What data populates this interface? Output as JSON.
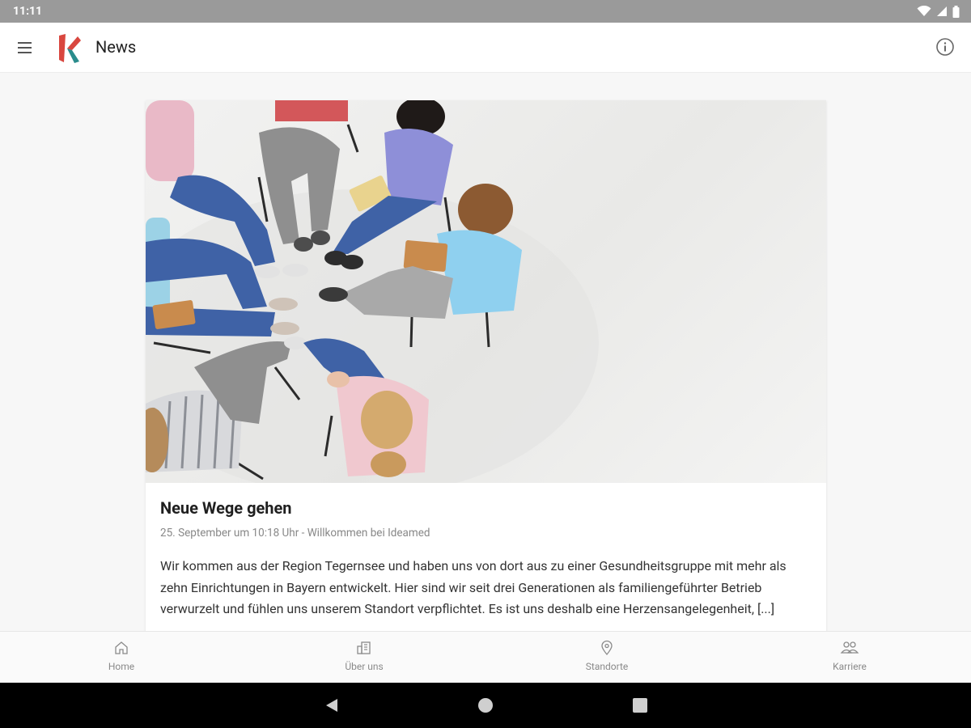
{
  "status_bar": {
    "time": "11:11"
  },
  "app_bar": {
    "title": "News"
  },
  "article": {
    "title": "Neue Wege gehen",
    "meta": "25. September um 10:18 Uhr - Willkommen bei Ideamed",
    "body": "Wir kommen aus der Region Tegernsee und haben uns von dort aus zu einer Gesundheitsgruppe mit mehr als zehn Einrichtungen in Bayern entwickelt. Hier sind wir seit drei Generationen als familiengeführter Betrieb verwurzelt und fühlen uns unserem Standort verpflichtet. Es ist uns deshalb eine Herzensangelegenheit, [...]"
  },
  "bottom_nav": {
    "items": [
      {
        "label": "Home",
        "icon": "home-icon"
      },
      {
        "label": "Über uns",
        "icon": "building-icon"
      },
      {
        "label": "Standorte",
        "icon": "location-pin-icon"
      },
      {
        "label": "Karriere",
        "icon": "people-icon"
      }
    ]
  },
  "colors": {
    "logo_red": "#d9473f",
    "logo_teal": "#2a8c8c",
    "status_bar": "#9a9a9a"
  }
}
